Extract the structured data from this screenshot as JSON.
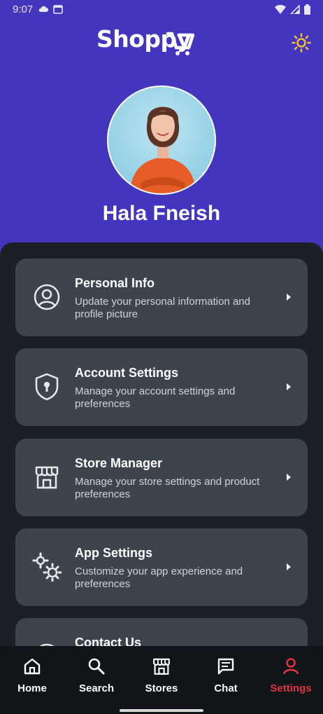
{
  "status_bar": {
    "time": "9:07"
  },
  "header": {
    "logo_text": "Shoppy",
    "theme_icon": "sun-icon",
    "accent_color": "#4435be"
  },
  "profile": {
    "name": "Hala Fneish"
  },
  "menu": [
    {
      "title": "Personal Info",
      "description": "Update your personal information and profile picture",
      "icon": "user-circle-icon"
    },
    {
      "title": "Account Settings",
      "description": "Manage your account settings and preferences",
      "icon": "shield-lock-icon"
    },
    {
      "title": "Store Manager",
      "description": "Manage your store settings and product preferences",
      "icon": "store-icon"
    },
    {
      "title": "App Settings",
      "description": "Customize your app experience and preferences",
      "icon": "gears-icon"
    },
    {
      "title": "Contact Us",
      "description": "",
      "icon": "contact-icon"
    }
  ],
  "bottom_nav": {
    "active_color": "#e0353f",
    "items": [
      {
        "label": "Home",
        "icon": "home-icon"
      },
      {
        "label": "Search",
        "icon": "search-icon"
      },
      {
        "label": "Stores",
        "icon": "store-icon"
      },
      {
        "label": "Chat",
        "icon": "chat-icon"
      },
      {
        "label": "Settings",
        "icon": "user-icon"
      }
    ]
  }
}
